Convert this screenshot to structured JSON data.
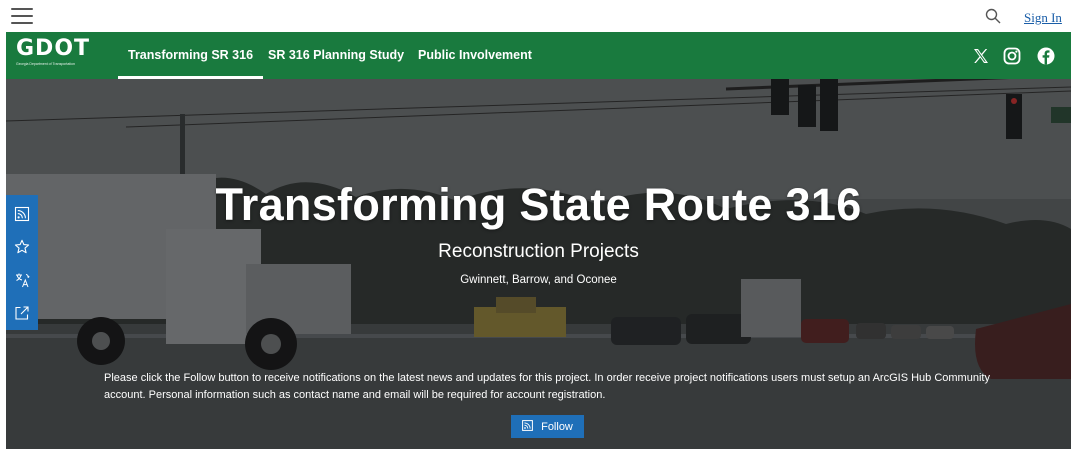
{
  "header": {
    "menu_icon": "hamburger-icon",
    "search_icon": "search-icon",
    "sign_in": "Sign In"
  },
  "nav": {
    "logo_text": "GDOT",
    "logo_subtext": "Georgia Department of Transportation",
    "links": [
      {
        "label": "Transforming SR 316",
        "active": true
      },
      {
        "label": "SR 316 Planning Study",
        "active": false
      },
      {
        "label": "Public Involvement",
        "active": false
      }
    ],
    "social": [
      "x-icon",
      "instagram-icon",
      "facebook-icon"
    ]
  },
  "hero": {
    "title": "Transforming State Route 316",
    "subtitle": "Reconstruction Projects",
    "location": "Gwinnett, Barrow, and Oconee",
    "note": "Please click the Follow button to receive notifications on the latest news and updates for this project. In order receive project notifications users must setup an ArcGIS Hub Community account. Personal information such as contact name and email will be required for account registration.",
    "follow_label": "Follow",
    "follow_icon": "follow-icon"
  },
  "side_toolbar": {
    "icons": [
      "follow-icon",
      "star-icon",
      "translate-icon",
      "share-icon"
    ]
  },
  "colors": {
    "nav_green": "#197a3e",
    "accent_blue": "#1f6fb8",
    "link_blue": "#1a5ea8"
  }
}
